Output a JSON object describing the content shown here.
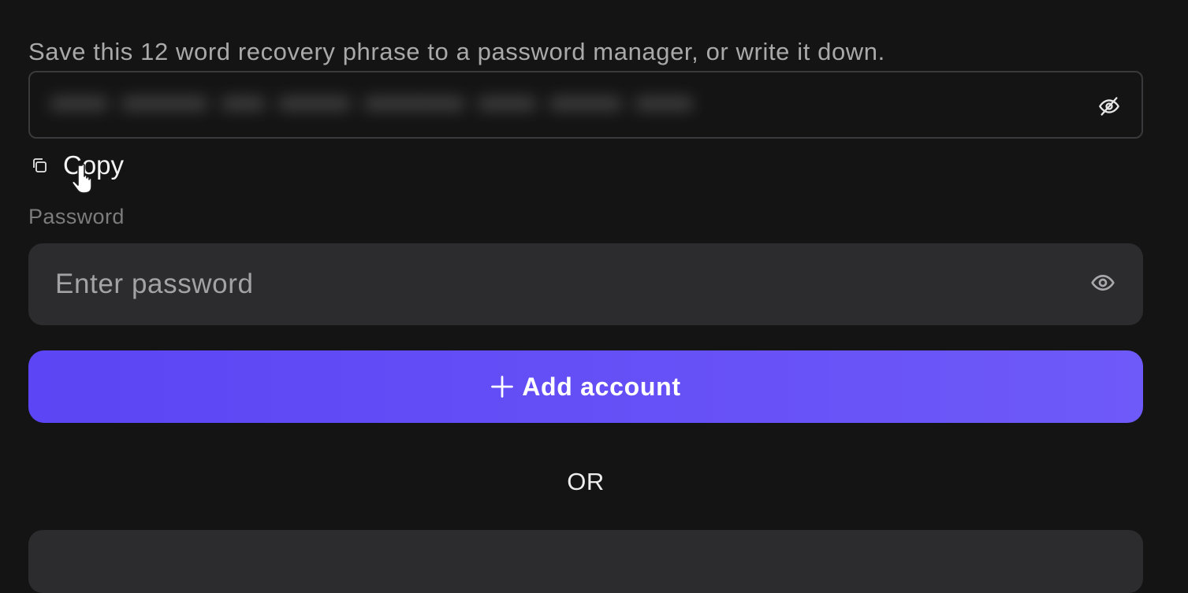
{
  "recovery": {
    "instructions": "Save this 12 word recovery phrase to a password manager, or write it down.",
    "toggle_icon": "eye-off-icon",
    "copy_label": "Copy",
    "copy_icon": "copy-icon"
  },
  "password": {
    "label": "Password",
    "placeholder": "Enter password",
    "value": "",
    "toggle_icon": "eye-icon"
  },
  "actions": {
    "add_account_label": "Add account",
    "add_account_icon": "plus-icon",
    "or_text": "OR"
  },
  "colors": {
    "background": "#141414",
    "field_background": "#2c2c2f",
    "accent_start": "#5b45f4",
    "accent_end": "#6e59f9",
    "muted_text": "#a9a9a9"
  }
}
